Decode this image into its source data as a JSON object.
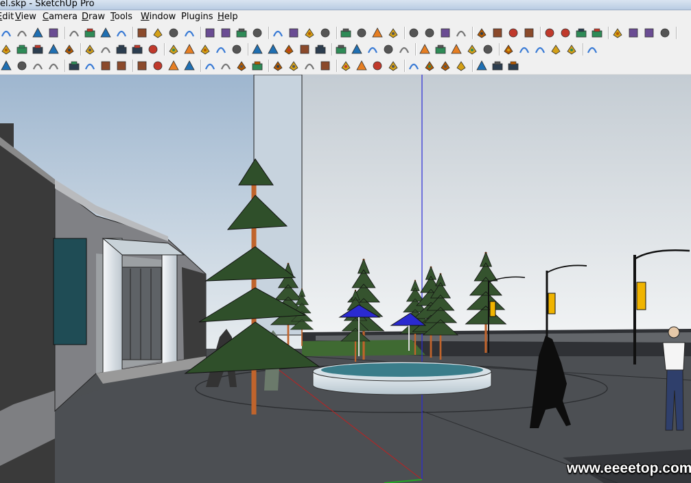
{
  "window": {
    "title": "el.skp - SketchUp Pro"
  },
  "menu": [
    {
      "accel": "E",
      "rest": "dit",
      "label": "Edit"
    },
    {
      "accel": "V",
      "rest": "iew",
      "label": "View"
    },
    {
      "accel": "C",
      "rest": "amera",
      "label": "Camera"
    },
    {
      "accel": "D",
      "rest": "raw",
      "label": "Draw"
    },
    {
      "accel": "T",
      "rest": "ools",
      "label": "Tools"
    },
    {
      "accel": "W",
      "rest": "indow",
      "label": "Window"
    },
    {
      "accel": "",
      "rest": "Plugins",
      "label": "Plugins"
    },
    {
      "accel": "H",
      "rest": "elp",
      "label": "Help"
    }
  ],
  "toolbars": {
    "row1": [
      "line",
      "rectangle",
      "circle",
      "arc",
      "eraser",
      "paint-bucket",
      "make-component",
      "push-pull",
      "move",
      "rotate",
      "follow-me",
      "scale",
      "offset",
      "orbit",
      "pan",
      "zoom",
      "zoom-extents",
      "previous-view",
      "next-view",
      "tape-measure",
      "dimension",
      "protractor",
      "text",
      "axes",
      "3d-text",
      "delete",
      "grid",
      "polygon",
      "rotated-rectangle",
      "arc-2pt",
      "arc-3pt",
      "helix",
      "plane",
      "cone",
      "pyramid",
      "sphere",
      "box",
      "torus",
      "tube",
      "dome",
      "wedge"
    ],
    "row2": [
      "new",
      "save",
      "warehouse",
      "share",
      "print",
      "model-info",
      "undo",
      "redo",
      "cut",
      "copy",
      "paste",
      "erase-selection",
      "iso",
      "top",
      "front",
      "right",
      "back",
      "left",
      "bottom",
      "xray",
      "wireframe",
      "hidden-line",
      "shaded",
      "textured",
      "monochrome",
      "section-plane",
      "section-display",
      "section-cut",
      "solid-union",
      "solid-subtract",
      "solid-intersect",
      "sandbox-from-contours",
      "sandbox-from-scratch",
      "smoove",
      "stamp",
      "drape"
    ],
    "row3": [
      "freehand",
      "bezier",
      "polyline",
      "warning",
      "explode",
      "triangulate",
      "mirror",
      "array",
      "flip",
      "flag",
      "spin",
      "component",
      "weld",
      "quad-face",
      "texture",
      "uv",
      "paint",
      "curve-loft",
      "skin",
      "patch",
      "extrude",
      "shell",
      "joint-push-pull",
      "vector-push-pull",
      "normal-push-pull",
      "cut-edge",
      "chamfer",
      "round-corner",
      "bend",
      "fillet",
      "taper"
    ]
  },
  "scene": {
    "axes": {
      "blue": "#2b2bd6",
      "red": "#c02020",
      "green": "#25a825"
    },
    "sky_top": "#9eb6cf",
    "sky_bottom": "#e7ecef",
    "ground": "#4f5256",
    "foliage": "#2f4f2a",
    "trunk": "#c0642c",
    "umbrella": "#2a2ad0",
    "lamp_banner": "#f0b400",
    "pool_water": "#3a7d8a"
  },
  "watermark": "www.eeeetop.com"
}
